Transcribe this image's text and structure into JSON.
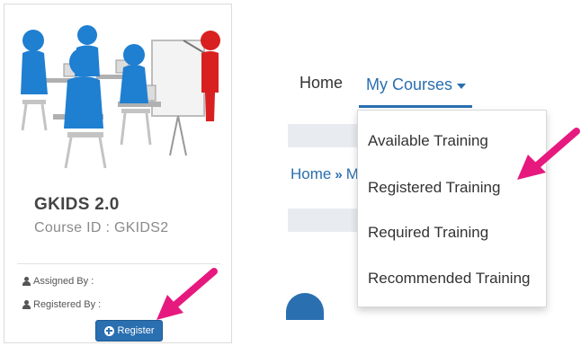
{
  "course_card": {
    "title": "GKIDS 2.0",
    "course_id": "Course ID : GKIDS2",
    "assigned_by_label": "Assigned By :",
    "registered_by_label": "Registered By :",
    "register_label": "Register",
    "image_icon": "classroom-training-illustration"
  },
  "nav": {
    "home_label": "Home",
    "my_courses_label": "My Courses",
    "breadcrumb_home": "Home",
    "breadcrumb_sep": "»",
    "breadcrumb_next": "M",
    "dropdown_items": [
      "Available Training",
      "Registered Training",
      "Required Training",
      "Recommended Training"
    ]
  },
  "colors": {
    "accent": "#2a6fb0",
    "highlight_arrow": "#e6197f",
    "band": "#e8ecf0"
  }
}
